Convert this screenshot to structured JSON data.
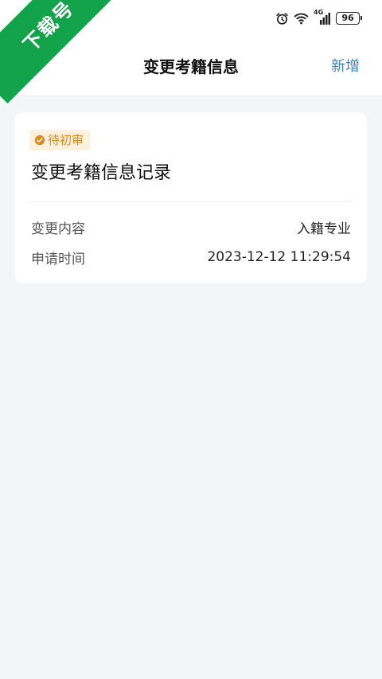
{
  "status_bar": {
    "battery": "96",
    "network": "4G",
    "icons": [
      "alarm-icon",
      "wifi-icon",
      "signal-icon",
      "battery-icon"
    ]
  },
  "watermark": {
    "text": "下载号"
  },
  "nav": {
    "back_icon": "chevron-left-icon",
    "title": "变更考籍信息",
    "action_label": "新增"
  },
  "record": {
    "status": "待初审",
    "status_icon": "check-circle-icon",
    "title": "变更考籍信息记录",
    "fields": [
      {
        "label": "变更内容",
        "value": "入籍专业"
      },
      {
        "label": "申请时间",
        "value": "2023-12-12 11:29:54"
      }
    ]
  },
  "colors": {
    "accent": "#3f86c2",
    "status_text": "#dd8a1c",
    "status_bg": "#fdf1dd",
    "watermark_bg": "#13a34a",
    "page_bg": "#f4f5f7"
  }
}
